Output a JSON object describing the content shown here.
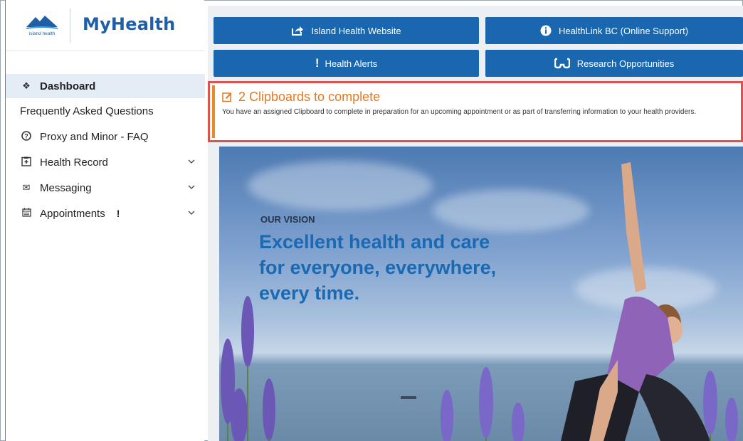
{
  "brand": {
    "logo_small": "island health",
    "app_name": "MyHealth"
  },
  "sidebar": {
    "items": [
      {
        "label": "Dashboard",
        "icon": "home-icon",
        "active": true
      },
      {
        "label": "Frequently Asked Questions"
      },
      {
        "label": "Proxy and Minor - FAQ",
        "icon": "question-circle-icon"
      },
      {
        "label": "Health Record",
        "icon": "health-record-icon",
        "expandable": true
      },
      {
        "label": "Messaging",
        "icon": "envelope-icon",
        "expandable": true
      },
      {
        "label": "Appointments",
        "icon": "calendar-icon",
        "expandable": true,
        "alert": "!"
      }
    ]
  },
  "quicklinks": {
    "island_health": "Island Health Website",
    "healthlink": "HealthLink BC (Online Support)",
    "health_alerts": "Health Alerts",
    "health_alerts_icon": "!",
    "research": "Research Opportunities"
  },
  "clipboard_alert": {
    "title": "2 Clipboards to complete",
    "text": "You have an assigned Clipboard to complete in preparation for an upcoming appointment or as part of transferring information to your health providers."
  },
  "hero": {
    "kicker": "OUR VISION",
    "line1": "Excellent health and care",
    "line2": "for everyone, everywhere,",
    "line3": "every time."
  },
  "colors": {
    "primary": "#1a67b0",
    "alert_orange": "#e07a22",
    "highlight_red": "#d9534f",
    "active_bg": "#e4edf5"
  }
}
